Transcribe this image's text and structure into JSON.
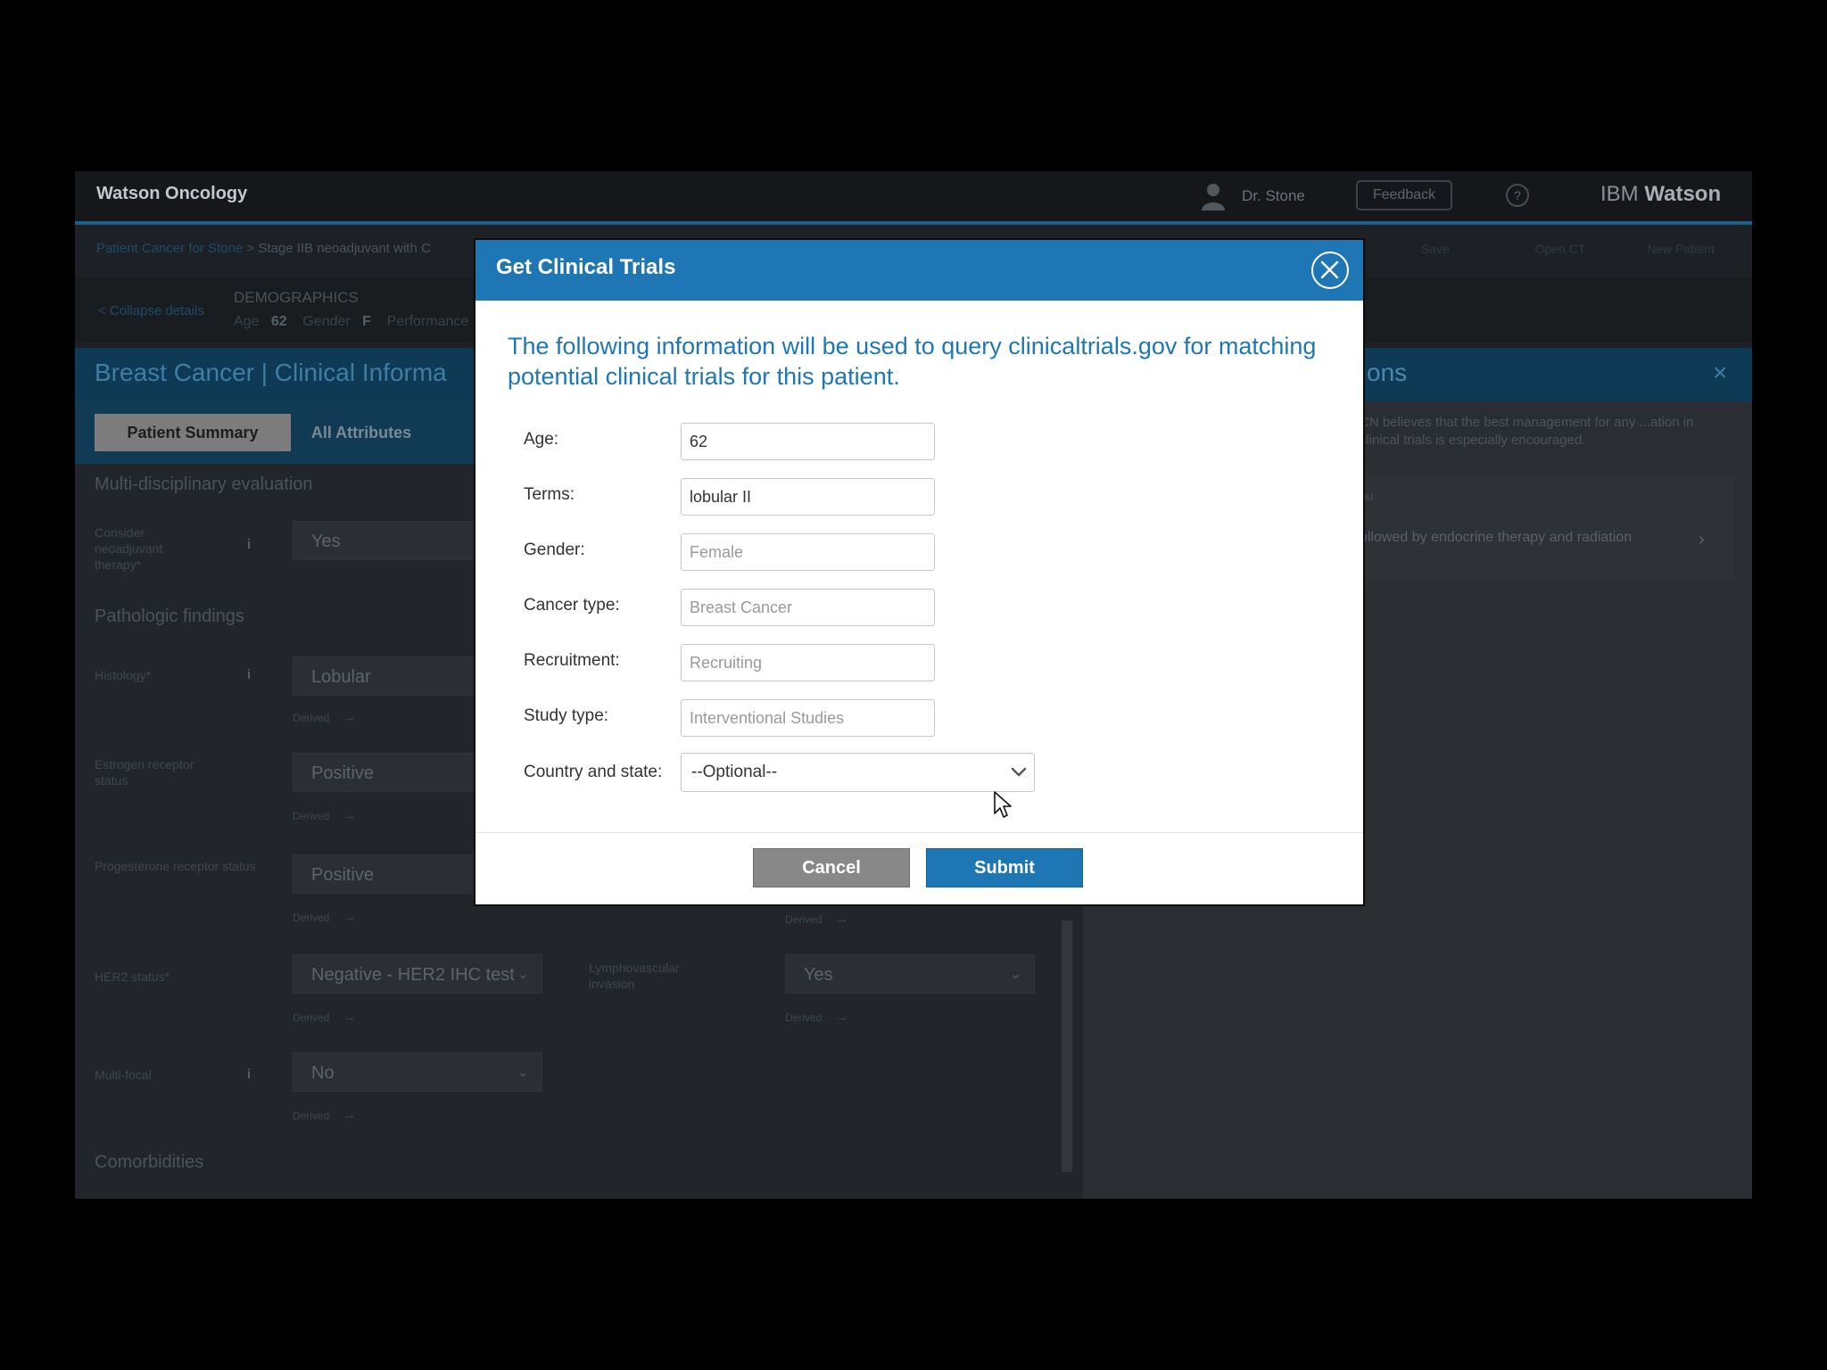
{
  "app": {
    "brand": "Watson Oncology",
    "user_name": "Dr. Stone",
    "feedback_label": "Feedback",
    "help_glyph": "?",
    "ibm_prefix": "IBM",
    "ibm_suffix": "Watson",
    "breadcrumb_link": "Patient Cancer for Stone",
    "breadcrumb_rest": " > Stage IIB neoadjuvant with C",
    "header_buttons": [
      "Save",
      "Open CT",
      "New Patient"
    ],
    "demographics": {
      "link": "< Collapse details",
      "title": "DEMOGRAPHICS",
      "age_label": "Age",
      "age_value": "62",
      "gender_label": "Gender",
      "gender_value": "F",
      "performance_label": "Performance"
    },
    "banner_title": "Breast Cancer  |  Clinical Informa",
    "tabs": {
      "patient_summary": "Patient Summary",
      "all_attributes": "All Attributes"
    },
    "sections": {
      "mde": "Multi-disciplinary evaluation",
      "pathologic": "Pathologic findings",
      "comorbidities": "Comorbidities"
    },
    "fields": {
      "neoadjuvant": {
        "label": "Consider neoadjuvant therapy*",
        "value": "Yes"
      },
      "histology": {
        "label": "Histology*",
        "value": "Lobular"
      },
      "estrogen": {
        "label": "Estrogen receptor status",
        "value": "Positive"
      },
      "progesterone": {
        "label": "Progesterone receptor status",
        "value": "Positive"
      },
      "her2": {
        "label": "HER2 status*",
        "value": "Negative - HER2 IHC test"
      },
      "lymph": {
        "label": "Lymphovascular invasion",
        "value": "Yes"
      },
      "multifocal": {
        "label": "Multi-focal",
        "value": "No"
      }
    },
    "derived_label": "Derived",
    "derived_arrow": "→",
    "info_glyph": "i",
    "chevron_glyph": "⌄",
    "right_panel": {
      "title": "tions",
      "close_glyph": "×",
      "text": "CN believes that the best management for any ...ation in clinical trials is especially encouraged.",
      "card_label": "ou",
      "card_text": "ollowed by endocrine therapy and radiation",
      "card_arrow": "›"
    }
  },
  "modal": {
    "title": "Get Clinical Trials",
    "intro": "The following information will be used to query clinicaltrials.gov for matching potential clinical trials for this patient.",
    "fields": {
      "age": {
        "label": "Age:",
        "value": "62"
      },
      "terms": {
        "label": "Terms:",
        "value": "lobular II"
      },
      "gender": {
        "label": "Gender:",
        "placeholder": "Female"
      },
      "cancer_type": {
        "label": "Cancer type:",
        "placeholder": "Breast Cancer"
      },
      "recruitment": {
        "label": "Recruitment:",
        "placeholder": "Recruiting"
      },
      "study_type": {
        "label": "Study type:",
        "placeholder": "Interventional Studies"
      }
    },
    "country": {
      "label": "Country and state:",
      "selected": "--Optional--"
    },
    "cancel_label": "Cancel",
    "submit_label": "Submit"
  },
  "colors": {
    "accent": "#1f76b4",
    "cancel_gray": "#888888",
    "dim_background": "#1d2024"
  }
}
